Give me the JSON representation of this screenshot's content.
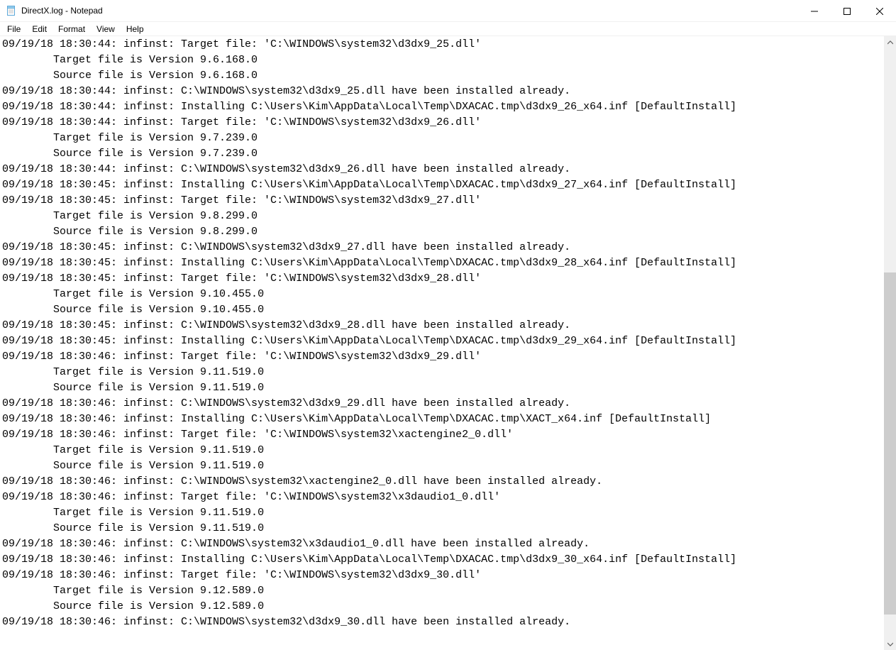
{
  "window": {
    "title": "DirectX.log - Notepad"
  },
  "menu": {
    "items": [
      "File",
      "Edit",
      "Format",
      "View",
      "Help"
    ]
  },
  "scrollbar": {
    "thumb_top_pct": 38,
    "thumb_height_pct": 58
  },
  "log_lines": [
    "09/19/18 18:30:44: infinst: Target file: 'C:\\WINDOWS\\system32\\d3dx9_25.dll'",
    "\tTarget file is Version 9.6.168.0",
    "\tSource file is Version 9.6.168.0",
    "09/19/18 18:30:44: infinst: C:\\WINDOWS\\system32\\d3dx9_25.dll have been installed already.",
    "09/19/18 18:30:44: infinst: Installing C:\\Users\\Kim\\AppData\\Local\\Temp\\DXACAC.tmp\\d3dx9_26_x64.inf [DefaultInstall]",
    "09/19/18 18:30:44: infinst: Target file: 'C:\\WINDOWS\\system32\\d3dx9_26.dll'",
    "\tTarget file is Version 9.7.239.0",
    "\tSource file is Version 9.7.239.0",
    "09/19/18 18:30:44: infinst: C:\\WINDOWS\\system32\\d3dx9_26.dll have been installed already.",
    "09/19/18 18:30:45: infinst: Installing C:\\Users\\Kim\\AppData\\Local\\Temp\\DXACAC.tmp\\d3dx9_27_x64.inf [DefaultInstall]",
    "09/19/18 18:30:45: infinst: Target file: 'C:\\WINDOWS\\system32\\d3dx9_27.dll'",
    "\tTarget file is Version 9.8.299.0",
    "\tSource file is Version 9.8.299.0",
    "09/19/18 18:30:45: infinst: C:\\WINDOWS\\system32\\d3dx9_27.dll have been installed already.",
    "09/19/18 18:30:45: infinst: Installing C:\\Users\\Kim\\AppData\\Local\\Temp\\DXACAC.tmp\\d3dx9_28_x64.inf [DefaultInstall]",
    "09/19/18 18:30:45: infinst: Target file: 'C:\\WINDOWS\\system32\\d3dx9_28.dll'",
    "\tTarget file is Version 9.10.455.0",
    "\tSource file is Version 9.10.455.0",
    "09/19/18 18:30:45: infinst: C:\\WINDOWS\\system32\\d3dx9_28.dll have been installed already.",
    "09/19/18 18:30:45: infinst: Installing C:\\Users\\Kim\\AppData\\Local\\Temp\\DXACAC.tmp\\d3dx9_29_x64.inf [DefaultInstall]",
    "09/19/18 18:30:46: infinst: Target file: 'C:\\WINDOWS\\system32\\d3dx9_29.dll'",
    "\tTarget file is Version 9.11.519.0",
    "\tSource file is Version 9.11.519.0",
    "09/19/18 18:30:46: infinst: C:\\WINDOWS\\system32\\d3dx9_29.dll have been installed already.",
    "09/19/18 18:30:46: infinst: Installing C:\\Users\\Kim\\AppData\\Local\\Temp\\DXACAC.tmp\\XACT_x64.inf [DefaultInstall]",
    "09/19/18 18:30:46: infinst: Target file: 'C:\\WINDOWS\\system32\\xactengine2_0.dll'",
    "\tTarget file is Version 9.11.519.0",
    "\tSource file is Version 9.11.519.0",
    "09/19/18 18:30:46: infinst: C:\\WINDOWS\\system32\\xactengine2_0.dll have been installed already.",
    "09/19/18 18:30:46: infinst: Target file: 'C:\\WINDOWS\\system32\\x3daudio1_0.dll'",
    "\tTarget file is Version 9.11.519.0",
    "\tSource file is Version 9.11.519.0",
    "09/19/18 18:30:46: infinst: C:\\WINDOWS\\system32\\x3daudio1_0.dll have been installed already.",
    "09/19/18 18:30:46: infinst: Installing C:\\Users\\Kim\\AppData\\Local\\Temp\\DXACAC.tmp\\d3dx9_30_x64.inf [DefaultInstall]",
    "09/19/18 18:30:46: infinst: Target file: 'C:\\WINDOWS\\system32\\d3dx9_30.dll'",
    "\tTarget file is Version 9.12.589.0",
    "\tSource file is Version 9.12.589.0",
    "09/19/18 18:30:46: infinst: C:\\WINDOWS\\system32\\d3dx9_30.dll have been installed already."
  ]
}
